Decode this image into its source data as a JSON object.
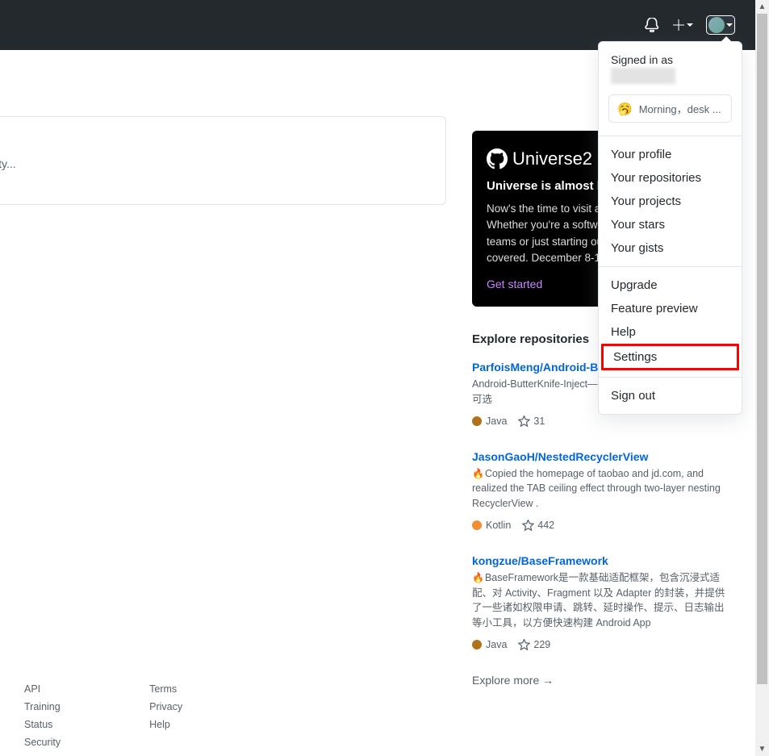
{
  "header": {},
  "feed": {
    "placeholder_text": "tivity..."
  },
  "promo": {
    "logo_text": "Universe2",
    "headline": "Universe is almost h",
    "body": "Now's the time to visit and plan your schedule. Whether you're a software leader running teams or just starting out, we've got you covered. December 8-10.",
    "cta": "Get started"
  },
  "explore": {
    "title": "Explore repositories",
    "repos": [
      {
        "name": "ParfoisMeng/Android-Bu",
        "desc": "Android-ButterKnife-Inject—可选 Kotlin，可选初始化，可选",
        "lang": "Java",
        "lang_color": "#b07219",
        "stars": "31",
        "fire": false
      },
      {
        "name": "JasonGaoH/NestedRecyclerView",
        "desc": "Copied the homepage of taobao and jd.com, and realized the TAB ceiling effect through two-layer nesting RecyclerView .",
        "lang": "Kotlin",
        "lang_color": "#F18E33",
        "stars": "442",
        "fire": true
      },
      {
        "name": "kongzue/BaseFramework",
        "desc": "BaseFramework是一款基础适配框架，包含沉浸式适配、对 Activity、Fragment 以及 Adapter 的封装，并提供了一些诸如权限申请、跳转、延时操作、提示、日志输出等小工具，以方便快速构建 Android App",
        "lang": "Java",
        "lang_color": "#b07219",
        "stars": "229",
        "fire": true
      }
    ],
    "more_text": "Explore more →"
  },
  "dropdown": {
    "signed_in_label": "Signed in as",
    "status_text": "Morning，desk ...",
    "items_a": [
      "Your profile",
      "Your repositories",
      "Your projects",
      "Your stars",
      "Your gists"
    ],
    "items_b": [
      "Upgrade",
      "Feature preview",
      "Help",
      "Settings"
    ],
    "highlighted_index_b": 3,
    "items_c": [
      "Sign out"
    ]
  },
  "footer": {
    "col1": [
      "API",
      "Training",
      "Status",
      "Security"
    ],
    "col2": [
      "Terms",
      "Privacy",
      "Help"
    ]
  }
}
